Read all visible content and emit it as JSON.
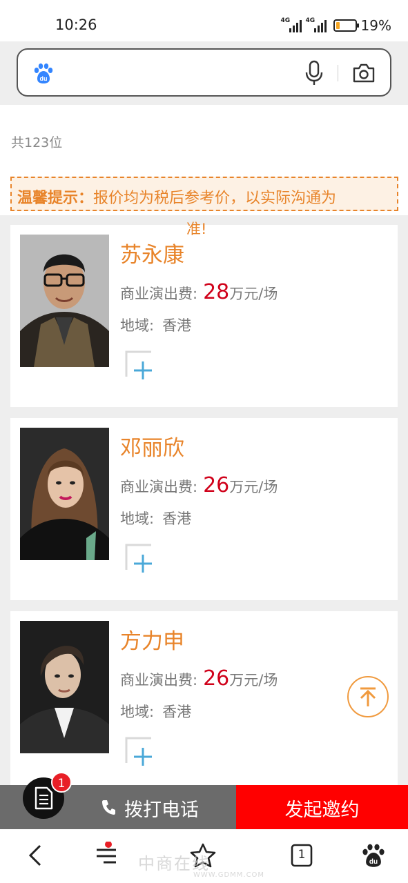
{
  "status": {
    "time": "10:26",
    "signal1": "4G",
    "signal2": "4G",
    "battery": "19%",
    "battery_level": 0.19
  },
  "search": {
    "placeholder": ""
  },
  "list_meta": {
    "count_text": "共123位"
  },
  "tip": {
    "label": "温馨提示：",
    "text": "报价均为税后参考价，以实际沟通为",
    "overflow": "准!"
  },
  "artists": [
    {
      "name": "苏永康",
      "fee_label": "商业演出费:",
      "fee_value": "28",
      "fee_unit": "万元/场",
      "region_label": "地域:",
      "region_value": "香港"
    },
    {
      "name": "邓丽欣",
      "fee_label": "商业演出费:",
      "fee_value": "26",
      "fee_unit": "万元/场",
      "region_label": "地域:",
      "region_value": "香港"
    },
    {
      "name": "方力申",
      "fee_label": "商业演出费:",
      "fee_value": "26",
      "fee_unit": "万元/场",
      "region_label": "地域:",
      "region_value": "香港"
    }
  ],
  "actions": {
    "call_label": "拨打电话",
    "invite_label": "发起邀约",
    "doc_badge": "1"
  },
  "nav": {
    "tabs_count": "1"
  },
  "watermark": {
    "text": "中商在线",
    "sub": "WWW.GDMM.COM"
  },
  "colors": {
    "accent": "#e8842a",
    "price": "#d0021b",
    "invite": "#ff0000",
    "call": "#6b6b6b"
  }
}
